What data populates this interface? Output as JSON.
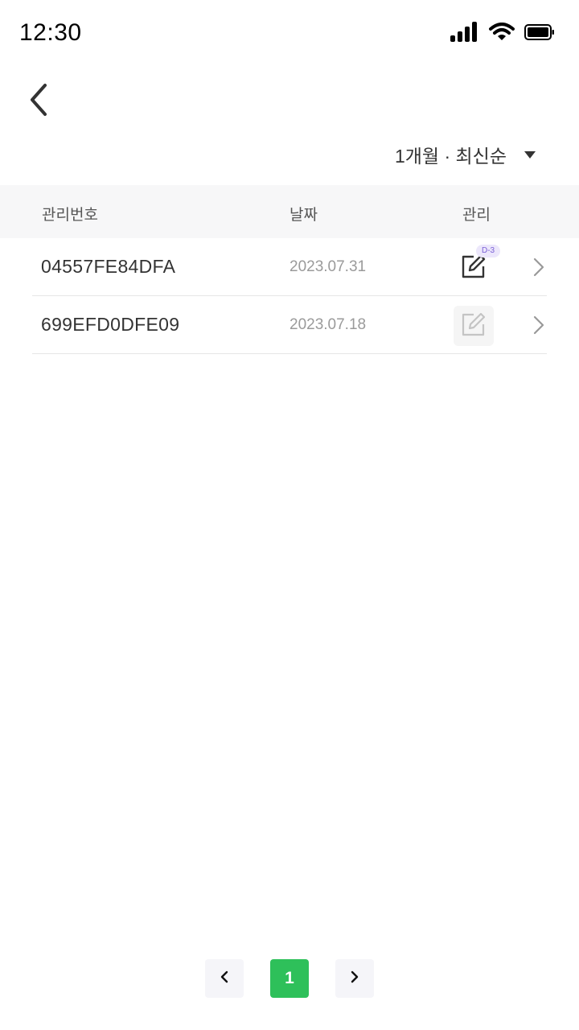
{
  "status_bar": {
    "time": "12:30"
  },
  "sort": {
    "label": "1개월 · 최신순"
  },
  "table": {
    "headers": {
      "id": "관리번호",
      "date": "날짜",
      "manage": "관리"
    },
    "rows": [
      {
        "id": "04557FE84DFA",
        "date": "2023.07.31",
        "badge": "D-3",
        "manage_enabled": true
      },
      {
        "id": "699EFD0DFE09",
        "date": "2023.07.18",
        "manage_enabled": false
      }
    ]
  },
  "pagination": {
    "current_page": "1"
  },
  "colors": {
    "accent": "#2ec05a",
    "badge_bg": "#ece7fb",
    "badge_text": "#7a5fd6",
    "header_bg": "#f7f7f8"
  }
}
